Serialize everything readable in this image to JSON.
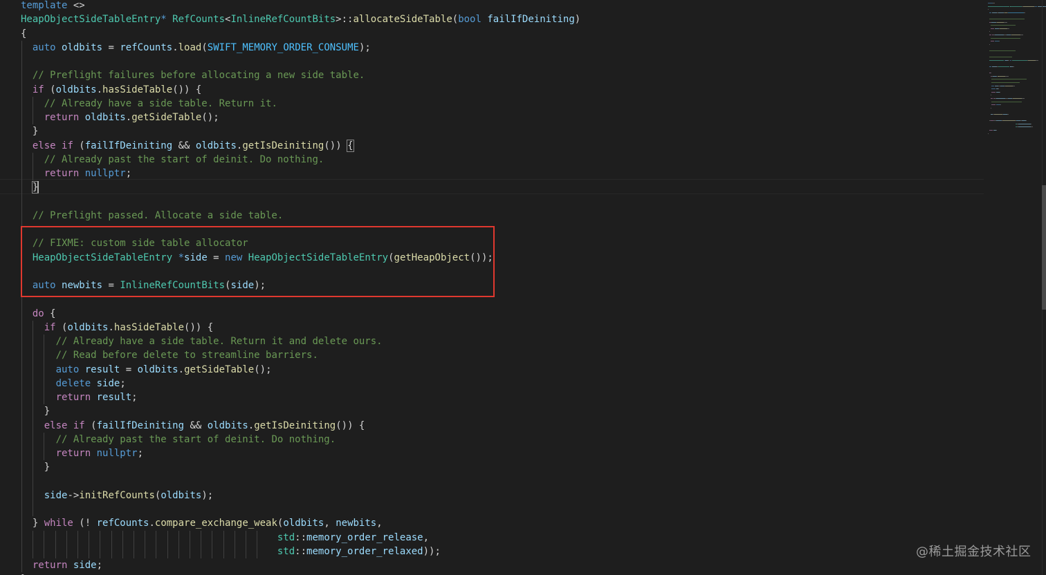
{
  "editor": {
    "colors": {
      "background": "#1e1e1e",
      "keyword": "#569cd6",
      "control": "#c586c0",
      "type": "#4ec9b0",
      "function": "#dcdcaa",
      "variable": "#9cdcfe",
      "comment": "#6a9955",
      "highlight_border": "#e0382f"
    },
    "lines": [
      {
        "indent": 0,
        "tokens": [
          {
            "t": "template",
            "c": "keyword"
          },
          {
            "t": " <>",
            "c": "plain"
          }
        ]
      },
      {
        "indent": 0,
        "tokens": [
          {
            "t": "HeapObjectSideTableEntry",
            "c": "type"
          },
          {
            "t": "* ",
            "c": "keyword"
          },
          {
            "t": "RefCounts",
            "c": "type"
          },
          {
            "t": "<",
            "c": "plain"
          },
          {
            "t": "InlineRefCountBits",
            "c": "type"
          },
          {
            "t": ">::",
            "c": "plain"
          },
          {
            "t": "allocateSideTable",
            "c": "func"
          },
          {
            "t": "(",
            "c": "plain"
          },
          {
            "t": "bool",
            "c": "keyword"
          },
          {
            "t": " ",
            "c": "plain"
          },
          {
            "t": "failIfDeiniting",
            "c": "var"
          },
          {
            "t": ")",
            "c": "plain"
          }
        ]
      },
      {
        "indent": 0,
        "tokens": [
          {
            "t": "{",
            "c": "plain"
          }
        ]
      },
      {
        "indent": 1,
        "tokens": [
          {
            "t": "auto",
            "c": "keyword"
          },
          {
            "t": " ",
            "c": "plain"
          },
          {
            "t": "oldbits",
            "c": "var"
          },
          {
            "t": " = ",
            "c": "plain"
          },
          {
            "t": "refCounts",
            "c": "var"
          },
          {
            "t": ".",
            "c": "plain"
          },
          {
            "t": "load",
            "c": "func"
          },
          {
            "t": "(",
            "c": "plain"
          },
          {
            "t": "SWIFT_MEMORY_ORDER_CONSUME",
            "c": "macro"
          },
          {
            "t": ");",
            "c": "plain"
          }
        ]
      },
      {
        "indent": 1,
        "tokens": []
      },
      {
        "indent": 1,
        "tokens": [
          {
            "t": "// Preflight failures before allocating a new side table.",
            "c": "comment"
          }
        ]
      },
      {
        "indent": 1,
        "tokens": [
          {
            "t": "if",
            "c": "control"
          },
          {
            "t": " (",
            "c": "plain"
          },
          {
            "t": "oldbits",
            "c": "var"
          },
          {
            "t": ".",
            "c": "plain"
          },
          {
            "t": "hasSideTable",
            "c": "func"
          },
          {
            "t": "()) {",
            "c": "plain"
          }
        ]
      },
      {
        "indent": 2,
        "tokens": [
          {
            "t": "// Already have a side table. Return it.",
            "c": "comment"
          }
        ]
      },
      {
        "indent": 2,
        "tokens": [
          {
            "t": "return",
            "c": "control"
          },
          {
            "t": " ",
            "c": "plain"
          },
          {
            "t": "oldbits",
            "c": "var"
          },
          {
            "t": ".",
            "c": "plain"
          },
          {
            "t": "getSideTable",
            "c": "func"
          },
          {
            "t": "();",
            "c": "plain"
          }
        ]
      },
      {
        "indent": 1,
        "tokens": [
          {
            "t": "}",
            "c": "plain"
          }
        ]
      },
      {
        "indent": 1,
        "tokens": [
          {
            "t": "else",
            "c": "control"
          },
          {
            "t": " ",
            "c": "plain"
          },
          {
            "t": "if",
            "c": "control"
          },
          {
            "t": " (",
            "c": "plain"
          },
          {
            "t": "failIfDeiniting",
            "c": "var"
          },
          {
            "t": " && ",
            "c": "plain"
          },
          {
            "t": "oldbits",
            "c": "var"
          },
          {
            "t": ".",
            "c": "plain"
          },
          {
            "t": "getIsDeiniting",
            "c": "func"
          },
          {
            "t": "()) ",
            "c": "plain"
          },
          {
            "t": "{",
            "c": "bracket"
          }
        ]
      },
      {
        "indent": 2,
        "tokens": [
          {
            "t": "// Already past the start of deinit. Do nothing.",
            "c": "comment"
          }
        ]
      },
      {
        "indent": 2,
        "tokens": [
          {
            "t": "return",
            "c": "control"
          },
          {
            "t": " ",
            "c": "plain"
          },
          {
            "t": "nullptr",
            "c": "keyword"
          },
          {
            "t": ";",
            "c": "plain"
          }
        ]
      },
      {
        "indent": 1,
        "tokens": [
          {
            "t": "}",
            "c": "bracket"
          }
        ]
      },
      {
        "indent": 1,
        "tokens": []
      },
      {
        "indent": 1,
        "tokens": [
          {
            "t": "// Preflight passed. Allocate a side table.",
            "c": "comment"
          }
        ]
      },
      {
        "indent": 1,
        "tokens": []
      },
      {
        "indent": 1,
        "tokens": [
          {
            "t": "// FIXME: custom side table allocator",
            "c": "comment"
          }
        ]
      },
      {
        "indent": 1,
        "tokens": [
          {
            "t": "HeapObjectSideTableEntry",
            "c": "type"
          },
          {
            "t": " ",
            "c": "plain"
          },
          {
            "t": "*",
            "c": "keyword"
          },
          {
            "t": "side",
            "c": "var"
          },
          {
            "t": " = ",
            "c": "plain"
          },
          {
            "t": "new",
            "c": "keyword"
          },
          {
            "t": " ",
            "c": "plain"
          },
          {
            "t": "HeapObjectSideTableEntry",
            "c": "type"
          },
          {
            "t": "(",
            "c": "plain"
          },
          {
            "t": "getHeapObject",
            "c": "func"
          },
          {
            "t": "());",
            "c": "plain"
          }
        ]
      },
      {
        "indent": 1,
        "tokens": []
      },
      {
        "indent": 1,
        "tokens": [
          {
            "t": "auto",
            "c": "keyword"
          },
          {
            "t": " ",
            "c": "plain"
          },
          {
            "t": "newbits",
            "c": "var"
          },
          {
            "t": " = ",
            "c": "plain"
          },
          {
            "t": "InlineRefCountBits",
            "c": "type"
          },
          {
            "t": "(",
            "c": "plain"
          },
          {
            "t": "side",
            "c": "var"
          },
          {
            "t": ");",
            "c": "plain"
          }
        ]
      },
      {
        "indent": 1,
        "tokens": []
      },
      {
        "indent": 1,
        "tokens": [
          {
            "t": "do",
            "c": "control"
          },
          {
            "t": " {",
            "c": "plain"
          }
        ]
      },
      {
        "indent": 2,
        "tokens": [
          {
            "t": "if",
            "c": "control"
          },
          {
            "t": " (",
            "c": "plain"
          },
          {
            "t": "oldbits",
            "c": "var"
          },
          {
            "t": ".",
            "c": "plain"
          },
          {
            "t": "hasSideTable",
            "c": "func"
          },
          {
            "t": "()) {",
            "c": "plain"
          }
        ]
      },
      {
        "indent": 3,
        "tokens": [
          {
            "t": "// Already have a side table. Return it and delete ours.",
            "c": "comment"
          }
        ]
      },
      {
        "indent": 3,
        "tokens": [
          {
            "t": "// Read before delete to streamline barriers.",
            "c": "comment"
          }
        ]
      },
      {
        "indent": 3,
        "tokens": [
          {
            "t": "auto",
            "c": "keyword"
          },
          {
            "t": " ",
            "c": "plain"
          },
          {
            "t": "result",
            "c": "var"
          },
          {
            "t": " = ",
            "c": "plain"
          },
          {
            "t": "oldbits",
            "c": "var"
          },
          {
            "t": ".",
            "c": "plain"
          },
          {
            "t": "getSideTable",
            "c": "func"
          },
          {
            "t": "();",
            "c": "plain"
          }
        ]
      },
      {
        "indent": 3,
        "tokens": [
          {
            "t": "delete",
            "c": "keyword"
          },
          {
            "t": " ",
            "c": "plain"
          },
          {
            "t": "side",
            "c": "var"
          },
          {
            "t": ";",
            "c": "plain"
          }
        ]
      },
      {
        "indent": 3,
        "tokens": [
          {
            "t": "return",
            "c": "control"
          },
          {
            "t": " ",
            "c": "plain"
          },
          {
            "t": "result",
            "c": "var"
          },
          {
            "t": ";",
            "c": "plain"
          }
        ]
      },
      {
        "indent": 2,
        "tokens": [
          {
            "t": "}",
            "c": "plain"
          }
        ]
      },
      {
        "indent": 2,
        "tokens": [
          {
            "t": "else",
            "c": "control"
          },
          {
            "t": " ",
            "c": "plain"
          },
          {
            "t": "if",
            "c": "control"
          },
          {
            "t": " (",
            "c": "plain"
          },
          {
            "t": "failIfDeiniting",
            "c": "var"
          },
          {
            "t": " && ",
            "c": "plain"
          },
          {
            "t": "oldbits",
            "c": "var"
          },
          {
            "t": ".",
            "c": "plain"
          },
          {
            "t": "getIsDeiniting",
            "c": "func"
          },
          {
            "t": "()) {",
            "c": "plain"
          }
        ]
      },
      {
        "indent": 3,
        "tokens": [
          {
            "t": "// Already past the start of deinit. Do nothing.",
            "c": "comment"
          }
        ]
      },
      {
        "indent": 3,
        "tokens": [
          {
            "t": "return",
            "c": "control"
          },
          {
            "t": " ",
            "c": "plain"
          },
          {
            "t": "nullptr",
            "c": "keyword"
          },
          {
            "t": ";",
            "c": "plain"
          }
        ]
      },
      {
        "indent": 2,
        "tokens": [
          {
            "t": "}",
            "c": "plain"
          }
        ]
      },
      {
        "indent": 2,
        "tokens": []
      },
      {
        "indent": 2,
        "tokens": [
          {
            "t": "side",
            "c": "var"
          },
          {
            "t": "->",
            "c": "plain"
          },
          {
            "t": "initRefCounts",
            "c": "func"
          },
          {
            "t": "(",
            "c": "plain"
          },
          {
            "t": "oldbits",
            "c": "var"
          },
          {
            "t": ");",
            "c": "plain"
          }
        ]
      },
      {
        "indent": 2,
        "tokens": []
      },
      {
        "indent": 1,
        "tokens": [
          {
            "t": "} ",
            "c": "plain"
          },
          {
            "t": "while",
            "c": "control"
          },
          {
            "t": " (! ",
            "c": "plain"
          },
          {
            "t": "refCounts",
            "c": "var"
          },
          {
            "t": ".",
            "c": "plain"
          },
          {
            "t": "compare_exchange_weak",
            "c": "func"
          },
          {
            "t": "(",
            "c": "plain"
          },
          {
            "t": "oldbits",
            "c": "var"
          },
          {
            "t": ", ",
            "c": "plain"
          },
          {
            "t": "newbits",
            "c": "var"
          },
          {
            "t": ",",
            "c": "plain"
          }
        ]
      },
      {
        "indent": 22,
        "tokens": [
          {
            "t": "std",
            "c": "ns"
          },
          {
            "t": "::",
            "c": "plain"
          },
          {
            "t": "memory_order_release",
            "c": "var"
          },
          {
            "t": ",",
            "c": "plain"
          }
        ]
      },
      {
        "indent": 22,
        "tokens": [
          {
            "t": "std",
            "c": "ns"
          },
          {
            "t": "::",
            "c": "plain"
          },
          {
            "t": "memory_order_relaxed",
            "c": "var"
          },
          {
            "t": "));",
            "c": "plain"
          }
        ]
      },
      {
        "indent": 1,
        "tokens": [
          {
            "t": "return",
            "c": "control"
          },
          {
            "t": " ",
            "c": "plain"
          },
          {
            "t": "side",
            "c": "var"
          },
          {
            "t": ";",
            "c": "plain"
          }
        ]
      },
      {
        "indent": 0,
        "tokens": [
          {
            "t": "}",
            "c": "plain"
          }
        ]
      }
    ]
  },
  "watermark": "@稀土掘金技术社区"
}
